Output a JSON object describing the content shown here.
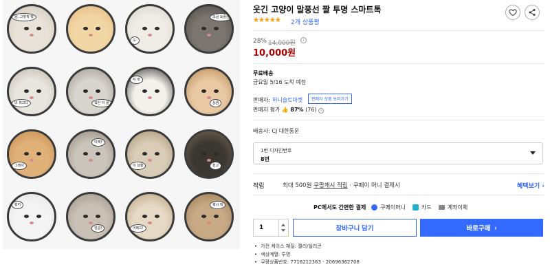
{
  "gallery": {
    "bubbles": [
      "응, 그렇게 뭐",
      "오-",
      "조금 요즘만",
      "상큼",
      "외한 이 꿀",
      "지 마",
      "미 최고다",
      "이 상황",
      "이해?",
      "뭐지",
      "어에드!",
      "최고",
      "앙큼!",
      "혹시 뭐",
      "그래서"
    ]
  },
  "product": {
    "title": "웃긴 고양이 말풍선 짤 투명 스마트톡",
    "stars": "★★★★★",
    "review_count": "2개 상품평",
    "discount": "28%",
    "original_price": "14,000원",
    "price": "10,000원"
  },
  "shipping": {
    "title": "무료배송",
    "date": "금요일 5/16 도착 예정",
    "seller_label": "판매자:",
    "seller_name": "허니슬트마켓",
    "seller_btn": "판매자 상품 보러가기",
    "rating_label": "판매자 평가",
    "rating_value": "87%",
    "rating_count": "(76)",
    "delivery": "배송사: CJ 대한통운"
  },
  "option": {
    "label": "1번 디자인번호",
    "value": "8번"
  },
  "accumulate": {
    "label": "적립",
    "text_pre": "최대 500원",
    "text_link": "쿠팡캐시 적립",
    "text_post": "· 쿠페이 머니 결제시",
    "benefit": "혜택보기 ›"
  },
  "payment": {
    "title": "PC에서도 간편한 결제",
    "methods": [
      "쿠페이머니",
      "카드",
      "계좌이체"
    ],
    "colors": [
      "#346aff",
      "#20b0c8",
      "#888888"
    ]
  },
  "purchase": {
    "qty": "1",
    "cart": "장바구니 담기",
    "buy": "바로구매",
    "buy_arrow": "›"
  },
  "specs": [
    "가전 케이스 재질: 젤리/실리콘",
    "색상계열: 투명",
    "쿠팡상품번호: 7716212363 - 20696362708"
  ],
  "icons": {
    "heart": "heart-icon",
    "share": "share-icon",
    "info": "info-icon",
    "thumb": "thumbs-up-icon"
  }
}
